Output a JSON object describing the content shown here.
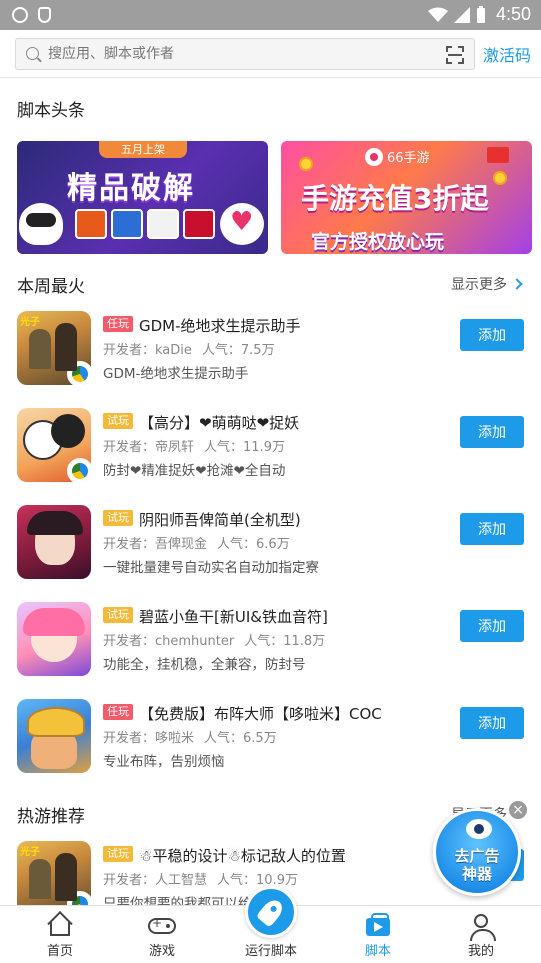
{
  "status_bar": {
    "time": "4:50"
  },
  "search": {
    "placeholder": "搜应用、脚本或作者",
    "activate_label": "激活码"
  },
  "headlines": {
    "title": "脚本头条",
    "banner1": {
      "tag": "五月上架",
      "title": "精品破解"
    },
    "banner2": {
      "brand": "66手游",
      "title": "手游充值3折起",
      "subtitle": "官方授权放心玩"
    }
  },
  "weekly_hot": {
    "title": "本周最火",
    "more_label": "显示更多",
    "items": [
      {
        "tag": "任玩",
        "tag_color": "#f25c6a",
        "name": "GDM-绝地求生提示助手",
        "developer": "开发者：kaDie",
        "popularity": "人气：7.5万",
        "desc": "GDM-绝地求生提示助手",
        "button": "添加",
        "icon": "pubg-game-icon"
      },
      {
        "tag": "试玩",
        "tag_color": "#f5b93a",
        "name": "【高分】❤萌萌哒❤捉妖",
        "developer": "开发者：帝夙轩",
        "popularity": "人气：11.9万",
        "desc": "防封❤精准捉妖❤抢滩❤全自动",
        "button": "添加",
        "icon": "mmz-game-icon"
      },
      {
        "tag": "试玩",
        "tag_color": "#f5b93a",
        "name": "阴阳师吾俾简单(全机型)",
        "developer": "开发者：吾俾现金",
        "popularity": "人气：6.6万",
        "desc": "一键批量建号自动实名自动加指定寮",
        "button": "添加",
        "icon": "yys-game-icon"
      },
      {
        "tag": "试玩",
        "tag_color": "#f5b93a",
        "name": "碧蓝小鱼干[新UI&铁血音符]",
        "developer": "开发者：chemhunter",
        "popularity": "人气：11.8万",
        "desc": "功能全，挂机稳，全兼容，防封号",
        "button": "添加",
        "icon": "azurlane-game-icon"
      },
      {
        "tag": "任玩",
        "tag_color": "#f25c6a",
        "name": "【免费版】布阵大师【哆啦米】COC",
        "developer": "开发者：哆啦米",
        "popularity": "人气：6.5万",
        "desc": "专业布阵，告别烦恼",
        "button": "添加",
        "icon": "coc-game-icon"
      }
    ]
  },
  "hot_games": {
    "title": "热游推荐",
    "more_label": "显示更多",
    "items": [
      {
        "tag": "试玩",
        "tag_color": "#f5b93a",
        "name": "☃平稳的设计☃标记敌人的位置",
        "developer": "开发者：人工智慧",
        "popularity": "人气：10.9万",
        "desc": "只要你想要的我都可以给",
        "button": "添加",
        "icon": "pubg-game-icon"
      }
    ]
  },
  "float_ad": {
    "line1": "去广告",
    "line2": "神器",
    "close": "×"
  },
  "bottom_nav": {
    "items": [
      {
        "label": "首页",
        "icon": "home-icon"
      },
      {
        "label": "游戏",
        "icon": "gamepad-icon"
      },
      {
        "label": "运行脚本",
        "icon": "rocket-icon"
      },
      {
        "label": "脚本",
        "icon": "script-icon",
        "active": true
      },
      {
        "label": "我的",
        "icon": "profile-icon"
      }
    ]
  },
  "colors": {
    "accent": "#1e9be8",
    "tag_red": "#f25c6a",
    "tag_yellow": "#f5b93a"
  }
}
